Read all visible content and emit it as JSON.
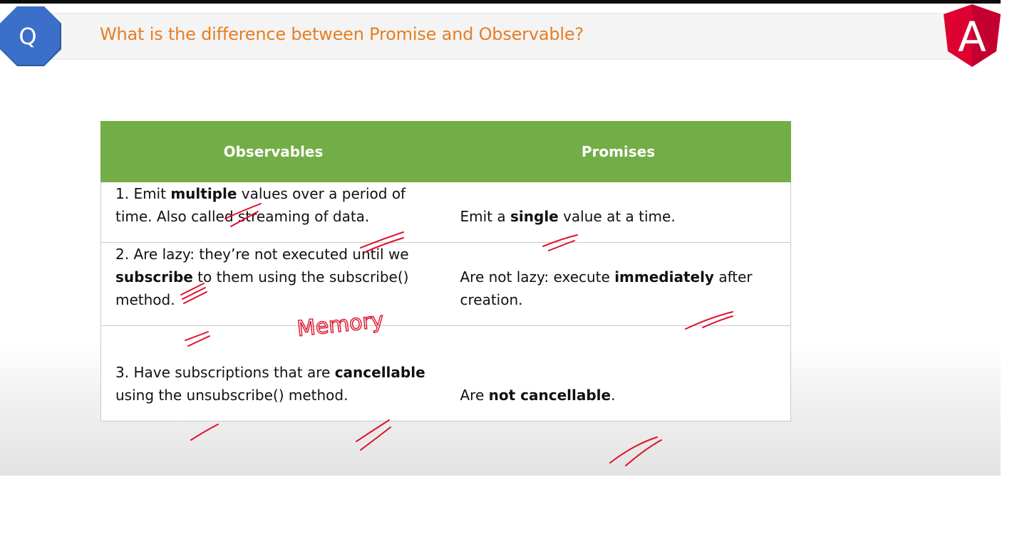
{
  "header": {
    "badge_letter": "Q",
    "question": "What is the difference between Promise and Observable?",
    "logo_letter": "A"
  },
  "table": {
    "columns": [
      "Observables",
      "Promises"
    ],
    "rows": [
      {
        "observables": {
          "pre": "1. Emit ",
          "bold": "multiple",
          "post": " values over a period of time. Also called streaming of data."
        },
        "promises": {
          "pre": "Emit a ",
          "bold": "single",
          "post": " value at a time."
        }
      },
      {
        "observables": {
          "pre": "2. Are lazy: they’re not executed until we ",
          "bold": "subscribe",
          "post": " to them using the subscribe() method."
        },
        "promises": {
          "pre": "Are not lazy: execute ",
          "bold": "immediately",
          "post": " after creation."
        }
      },
      {
        "observables": {
          "pre": "3. Have subscriptions that are ",
          "bold": "cancellable",
          "post": " using the unsubscribe() method."
        },
        "promises": {
          "pre": "Are ",
          "bold": "not cancellable",
          "post": "."
        }
      }
    ]
  },
  "annotation": {
    "handwritten_note": "Memory"
  },
  "colors": {
    "header_green": "#72ad46",
    "question_orange": "#e67e22",
    "badge_blue": "#3b6fc9",
    "angular_red": "#dd0031",
    "ink_red": "#e0102a"
  }
}
